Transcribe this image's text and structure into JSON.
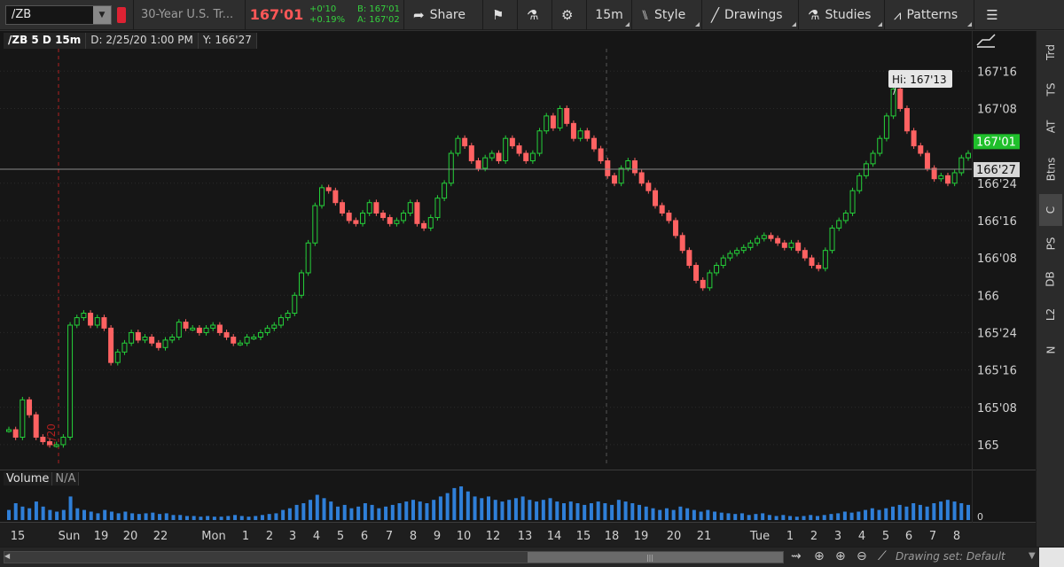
{
  "toolbar": {
    "symbol": "/ZB",
    "description": "30-Year U.S. Tr...",
    "last_price": "167'01",
    "net_change": "+0'10",
    "pct_change": "+0.19%",
    "bid": "B: 167'01",
    "ask": "A: 167'02",
    "share_label": "Share",
    "timeframe_label": "15m",
    "style_label": "Style",
    "drawings_label": "Drawings",
    "studies_label": "Studies",
    "patterns_label": "Patterns"
  },
  "chart_header": {
    "symbol": "/ZB 5 D 15m",
    "date": "D: 2/25/20 1:00 PM",
    "y": "Y: 166'27"
  },
  "price_axis": {
    "ticks": [
      {
        "label": "167'16",
        "value": 167.5
      },
      {
        "label": "167'08",
        "value": 167.25
      },
      {
        "label": "166'24",
        "value": 166.75
      },
      {
        "label": "166'16",
        "value": 166.5
      },
      {
        "label": "166'08",
        "value": 166.25
      },
      {
        "label": "166",
        "value": 166.0
      },
      {
        "label": "165'24",
        "value": 165.75
      },
      {
        "label": "165'16",
        "value": 165.5
      },
      {
        "label": "165'08",
        "value": 165.25
      },
      {
        "label": "165",
        "value": 165.0
      }
    ],
    "last_label": "167'01",
    "last_value": 167.03125,
    "cursor_label": "166'27",
    "cursor_value": 166.84375
  },
  "hi_label": "Hi: 167'13",
  "date_marker": "2/20",
  "time_axis": [
    "15",
    "Sun",
    "19",
    "20",
    "22",
    "Mon",
    "1",
    "2",
    "3",
    "4",
    "5",
    "6",
    "7",
    "8",
    "9",
    "10",
    "12",
    "13",
    "14",
    "15",
    "18",
    "19",
    "20",
    "21",
    "Tue",
    "1",
    "2",
    "3",
    "4",
    "5",
    "6",
    "7",
    "8"
  ],
  "volume_panel": {
    "label": "Volume",
    "value": "N/A",
    "zero_label": "0"
  },
  "sidebar_tabs": [
    "Trd",
    "TS",
    "AT",
    "Btns",
    "C",
    "PS",
    "DB",
    "L2",
    "N"
  ],
  "active_tab": "C",
  "drawing_set": "Drawing set: Default",
  "chart_data": {
    "type": "candlestick",
    "ylim": [
      164.875,
      167.65
    ],
    "price_series": [
      165.1,
      165.05,
      165.3,
      165.2,
      165.05,
      165.02,
      165.0,
      165.0,
      165.05,
      165.8,
      165.85,
      165.88,
      165.8,
      165.85,
      165.78,
      165.55,
      165.62,
      165.68,
      165.75,
      165.7,
      165.72,
      165.68,
      165.65,
      165.7,
      165.72,
      165.82,
      165.78,
      165.78,
      165.75,
      165.78,
      165.8,
      165.75,
      165.72,
      165.68,
      165.68,
      165.72,
      165.72,
      165.75,
      165.78,
      165.8,
      165.85,
      165.88,
      166.0,
      166.15,
      166.35,
      166.6,
      166.72,
      166.7,
      166.62,
      166.55,
      166.5,
      166.48,
      166.55,
      166.62,
      166.55,
      166.52,
      166.48,
      166.5,
      166.55,
      166.62,
      166.48,
      166.45,
      166.52,
      166.65,
      166.75,
      166.95,
      167.05,
      167.0,
      166.9,
      166.85,
      166.92,
      166.95,
      166.9,
      167.05,
      167.0,
      166.95,
      166.9,
      166.95,
      167.1,
      167.2,
      167.12,
      167.25,
      167.15,
      167.05,
      167.1,
      167.05,
      166.98,
      166.9,
      166.8,
      166.75,
      166.85,
      166.9,
      166.82,
      166.75,
      166.7,
      166.6,
      166.55,
      166.5,
      166.4,
      166.3,
      166.2,
      166.1,
      166.05,
      166.15,
      166.2,
      166.25,
      166.28,
      166.3,
      166.32,
      166.35,
      166.38,
      166.4,
      166.38,
      166.35,
      166.32,
      166.35,
      166.3,
      166.25,
      166.2,
      166.18,
      166.3,
      166.45,
      166.5,
      166.55,
      166.7,
      166.8,
      166.88,
      166.95,
      167.05,
      167.2,
      167.38,
      167.25,
      167.1,
      167.0,
      166.95,
      166.85,
      166.78,
      166.8,
      166.75,
      166.82,
      166.92,
      166.95
    ],
    "volume_scale": [
      0.3,
      0.5,
      0.4,
      0.35,
      0.55,
      0.4,
      0.3,
      0.25,
      0.3,
      0.7,
      0.35,
      0.3,
      0.25,
      0.2,
      0.3,
      0.25,
      0.2,
      0.25,
      0.2,
      0.18,
      0.2,
      0.22,
      0.18,
      0.2,
      0.15,
      0.15,
      0.12,
      0.12,
      0.1,
      0.12,
      0.1,
      0.1,
      0.12,
      0.15,
      0.12,
      0.1,
      0.12,
      0.15,
      0.18,
      0.2,
      0.3,
      0.35,
      0.45,
      0.5,
      0.6,
      0.75,
      0.65,
      0.55,
      0.4,
      0.45,
      0.35,
      0.4,
      0.5,
      0.45,
      0.35,
      0.4,
      0.45,
      0.5,
      0.55,
      0.6,
      0.55,
      0.5,
      0.6,
      0.7,
      0.8,
      0.95,
      1.0,
      0.85,
      0.7,
      0.65,
      0.7,
      0.6,
      0.55,
      0.6,
      0.65,
      0.7,
      0.6,
      0.55,
      0.6,
      0.65,
      0.55,
      0.5,
      0.55,
      0.5,
      0.45,
      0.5,
      0.55,
      0.5,
      0.45,
      0.6,
      0.55,
      0.5,
      0.45,
      0.4,
      0.35,
      0.3,
      0.35,
      0.3,
      0.4,
      0.35,
      0.3,
      0.25,
      0.3,
      0.25,
      0.22,
      0.2,
      0.18,
      0.2,
      0.15,
      0.18,
      0.2,
      0.15,
      0.12,
      0.15,
      0.12,
      0.1,
      0.12,
      0.15,
      0.12,
      0.15,
      0.18,
      0.2,
      0.25,
      0.22,
      0.25,
      0.3,
      0.35,
      0.3,
      0.35,
      0.4,
      0.45,
      0.4,
      0.5,
      0.45,
      0.4,
      0.5,
      0.55,
      0.6,
      0.55,
      0.5,
      0.45
    ],
    "up_color": "#25d13a",
    "down_color": "#ff6262",
    "volume_color": "#2f7fd8"
  }
}
